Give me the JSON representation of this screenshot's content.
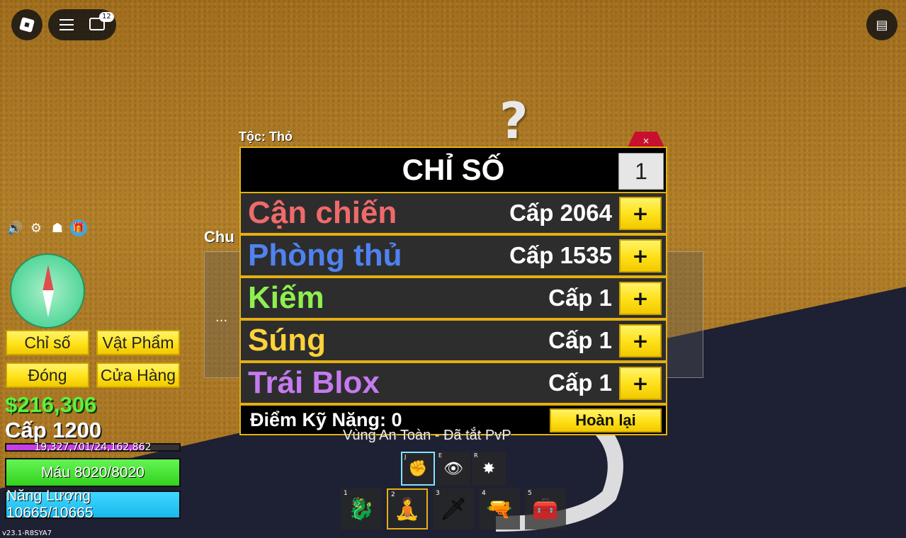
{
  "topbar": {
    "chat_badge": "12"
  },
  "race_label": "Tộc: Thỏ",
  "stats_panel": {
    "title": "CHỈ SỐ",
    "point_input": "1",
    "close_label": "×",
    "rows": [
      {
        "name": "Cận chiến",
        "level": "Cấp 2064",
        "color": "#f06a6a"
      },
      {
        "name": "Phòng thủ",
        "level": "Cấp 1535",
        "color": "#4f82f0"
      },
      {
        "name": "Kiếm",
        "level": "Cấp 1",
        "color": "#8ef04f"
      },
      {
        "name": "Súng",
        "level": "Cấp 1",
        "color": "#ffd23a"
      },
      {
        "name": "Trái Blox",
        "level": "Cấp 1",
        "color": "#c57af0"
      }
    ],
    "plus_label": "+",
    "skill_points": "Điểm Kỹ Năng: 0",
    "reset_label": "Hoàn lại"
  },
  "behind_panel": {
    "title": "Chu",
    "dots": "..."
  },
  "left_menu": {
    "stats_btn": "Chỉ số",
    "items_btn": "Vật Phẩm",
    "close_btn": "Đóng",
    "shop_btn": "Cửa Hàng"
  },
  "player": {
    "money": "$216,306",
    "level": "Cấp 1200",
    "xp": "19,327,701/24,162,862",
    "xp_fraction": 0.8,
    "health": "Máu 8020/8020",
    "energy": "Năng Lượng 10665/10665"
  },
  "safe_zone": "Vùng An Toàn - Đã tắt PvP",
  "skills": [
    {
      "key": "J"
    },
    {
      "key": "E"
    },
    {
      "key": "R"
    }
  ],
  "hotbar": [
    {
      "slot": "1"
    },
    {
      "slot": "2"
    },
    {
      "slot": "3"
    },
    {
      "slot": "4"
    },
    {
      "slot": "5"
    }
  ],
  "version": "v23.1-R8SYA7",
  "question_mark": "?"
}
